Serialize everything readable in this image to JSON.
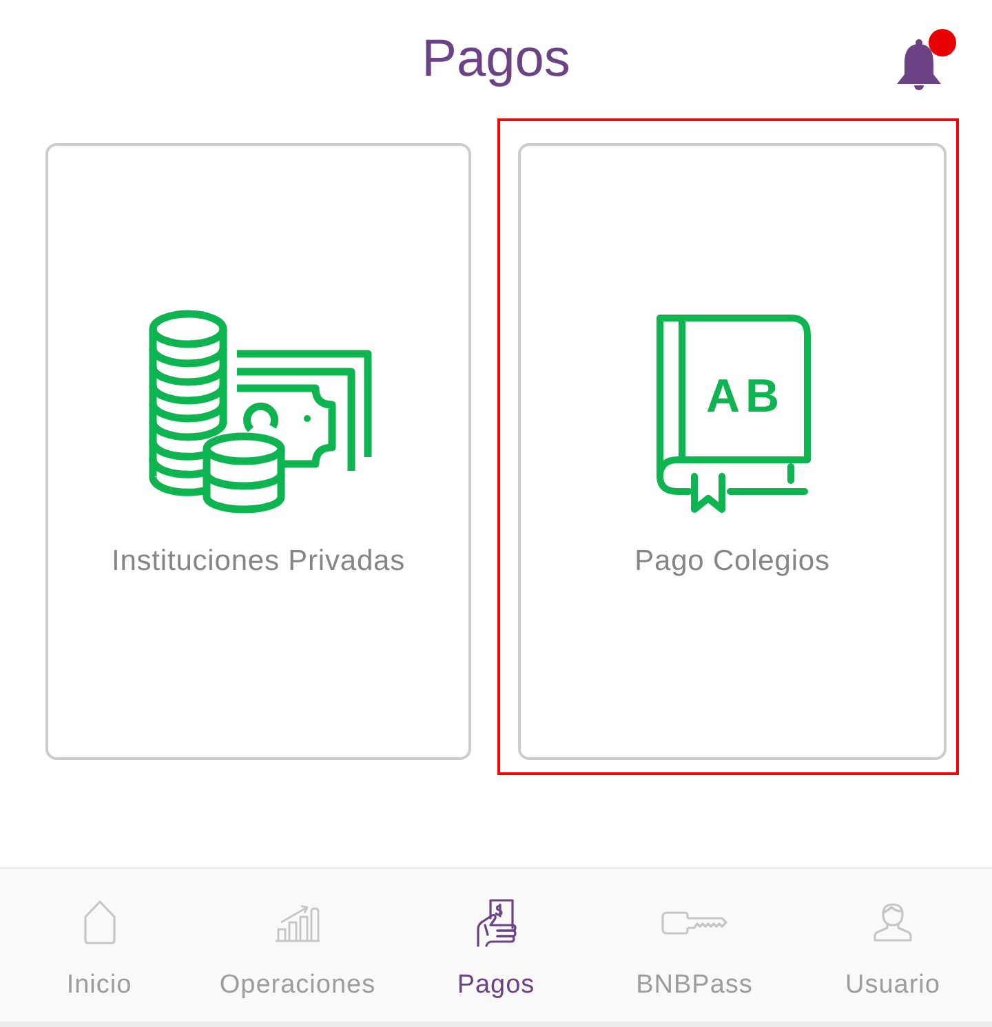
{
  "header": {
    "title": "Pagos",
    "notifications": {
      "unread": true
    }
  },
  "cards": [
    {
      "label": "Instituciones Privadas",
      "highlighted": false
    },
    {
      "label": "Pago Colegios",
      "icon_lettering": "AB",
      "highlighted": true
    }
  ],
  "nav": [
    {
      "label": "Inicio",
      "selected": false
    },
    {
      "label": "Operaciones",
      "selected": false
    },
    {
      "label": "Pagos",
      "selected": true
    },
    {
      "label": "BNBPass",
      "selected": false
    },
    {
      "label": "Usuario",
      "selected": false
    }
  ]
}
